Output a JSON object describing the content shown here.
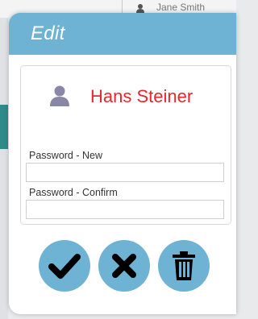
{
  "background": {
    "user_name": "Jane Smith"
  },
  "modal": {
    "title": "Edit",
    "user": {
      "name": "Hans Steiner",
      "icon": "user-icon"
    },
    "fields": {
      "password_new": {
        "label": "Password - New",
        "value": "",
        "placeholder": ""
      },
      "password_confirm": {
        "label": "Password - Confirm",
        "value": "",
        "placeholder": ""
      }
    },
    "actions": {
      "confirm_icon": "check-icon",
      "cancel_icon": "close-icon",
      "delete_icon": "trash-icon"
    }
  },
  "colors": {
    "header_bg": "#6eb2d4",
    "button_bg": "#6eb2d4",
    "user_name": "#e8262b",
    "user_icon": "#8a86a6"
  }
}
